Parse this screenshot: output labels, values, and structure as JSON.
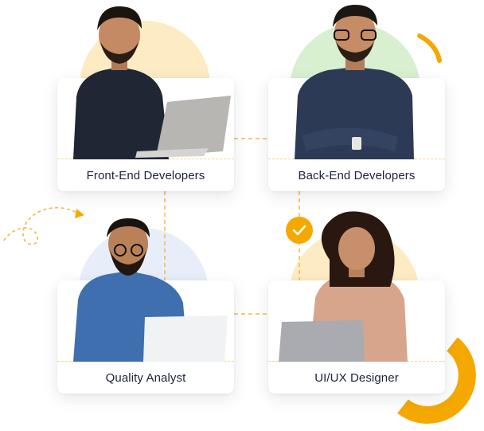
{
  "cards": [
    {
      "label": "Front-End Developers"
    },
    {
      "label": "Back-End Developers"
    },
    {
      "label": "Quality Analyst"
    },
    {
      "label": "UI/UX Designer"
    }
  ],
  "colors": {
    "accent": "#f5a800",
    "blob_yellow": "#fdebc4",
    "blob_green": "#d8f0cf",
    "blob_blue": "#e3ebf8",
    "label_text": "#1d2340",
    "dashed_line": "#f0b94a"
  },
  "icons": {
    "check": "check-icon",
    "dashed_arrow": "dashed-arrow-icon"
  }
}
